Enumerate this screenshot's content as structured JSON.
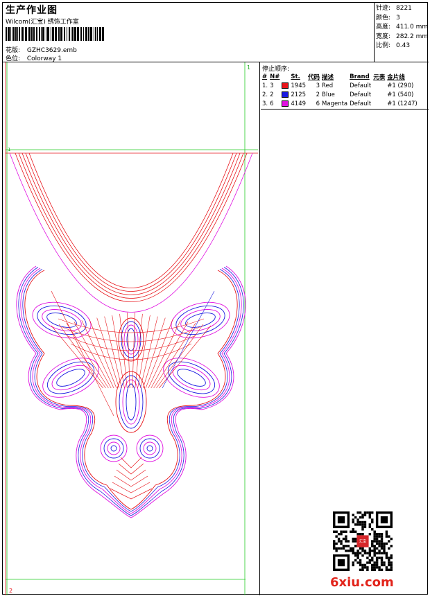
{
  "header": {
    "title": "生产作业图",
    "company": "Wilcom(汇宝) 绣饰工作室",
    "design_label": "花版:",
    "design_value": "GZHC3629.emb",
    "colorway_label": "色位:",
    "colorway_value": "Colorway 1"
  },
  "stats": [
    {
      "label": "针迹:",
      "value": "8221"
    },
    {
      "label": "颜色:",
      "value": "3"
    },
    {
      "label": "高度:",
      "value": "411.0 mm"
    },
    {
      "label": "宽度:",
      "value": "282.2 mm"
    },
    {
      "label": "比例:",
      "value": "0.43"
    }
  ],
  "sequence": {
    "title": "停止顺序:",
    "headers": [
      "#",
      "N#",
      "St.",
      "代码",
      "描述",
      "Brand",
      "元表",
      "金片线"
    ],
    "rows": [
      {
        "idx": "1.",
        "n": "3",
        "color": "#e8141a",
        "st": "1945",
        "code": "3",
        "desc": "Red",
        "brand": "Default",
        "sequin": "#1 (290)"
      },
      {
        "idx": "2.",
        "n": "2",
        "color": "#1a1ae0",
        "st": "2125",
        "code": "2",
        "desc": "Blue",
        "brand": "Default",
        "sequin": "#1 (540)"
      },
      {
        "idx": "3.",
        "n": "6",
        "color": "#e010e0",
        "st": "4149",
        "code": "6",
        "desc": "Magenta",
        "brand": "Default",
        "sequin": "#1 (1247)"
      }
    ]
  },
  "canvas": {
    "hoop_label_top": "1",
    "hoop_label_bottom": "2",
    "start_marker": "1",
    "colors": {
      "red": "#e8141a",
      "blue": "#1a1ae0",
      "magenta": "#e010e0",
      "guide": "#22cc22"
    }
  },
  "watermark": "6xiu.com",
  "qr_stamp_text": "汇宝"
}
